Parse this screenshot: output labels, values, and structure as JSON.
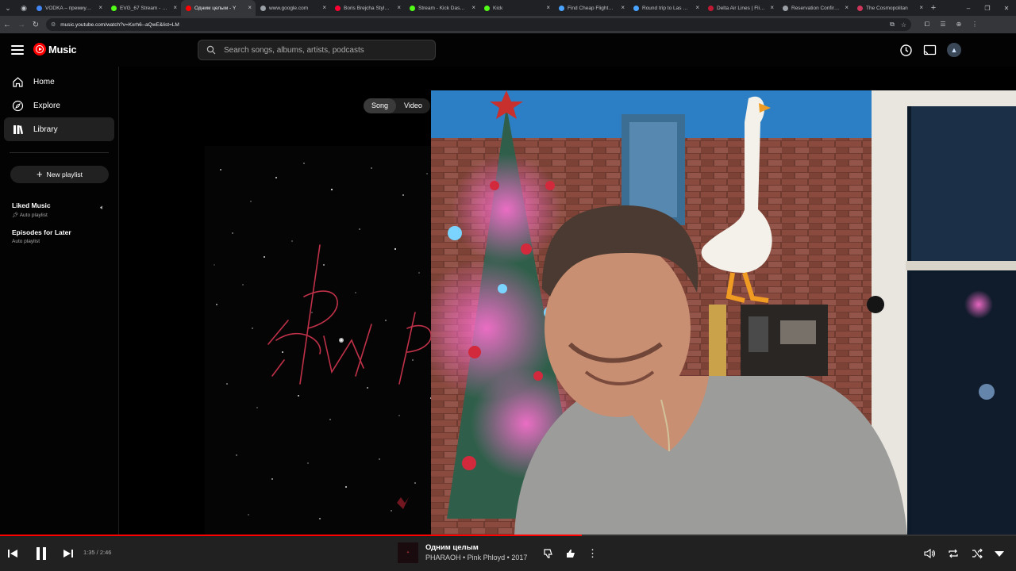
{
  "browser": {
    "tabs": [
      {
        "title": "VODKA – премиум с",
        "fav": "#4285f4"
      },
      {
        "title": "EVG_67 Stream - Watc",
        "fav": "#53fc18"
      },
      {
        "title": "Одним целым - Y",
        "fav": "#ff0000",
        "active": true
      },
      {
        "title": "www.google.com",
        "fav": "#9aa0a6"
      },
      {
        "title": "Boris Brejcha Style M",
        "fav": "#ff0033"
      },
      {
        "title": "Stream - Kick Dashbo",
        "fav": "#53fc18"
      },
      {
        "title": "Kick",
        "fav": "#53fc18"
      },
      {
        "title": "Find Cheap Flights fro",
        "fav": "#4aa3ff"
      },
      {
        "title": "Round trip to Las Veg",
        "fav": "#4aa3ff"
      },
      {
        "title": "Delta Air Lines | Fligh",
        "fav": "#c01933"
      },
      {
        "title": "Reservation Confirma",
        "fav": "#9aa0a6"
      },
      {
        "title": "The Cosmopolitan",
        "fav": "#d0355b"
      }
    ],
    "url": "music.youtube.com/watch?v=Kxrh6--aQwE&list=LM"
  },
  "header": {
    "logo_text": "Music",
    "search_placeholder": "Search songs, albums, artists, podcasts"
  },
  "sidebar": {
    "nav": [
      {
        "label": "Home"
      },
      {
        "label": "Explore"
      },
      {
        "label": "Library"
      }
    ],
    "new_playlist": "New playlist",
    "playlists": [
      {
        "title": "Liked Music",
        "subtitle": "Auto playlist"
      },
      {
        "title": "Episodes for Later",
        "subtitle": "Auto playlist"
      }
    ]
  },
  "main": {
    "toggle": {
      "song": "Song",
      "video": "Video"
    }
  },
  "player": {
    "time": "1:35 / 2:46",
    "progress": 0.573,
    "title": "Одним целым",
    "meta": "PHARAOH • Pink Phloyd • 2017"
  },
  "colors": {
    "accent": "#ff0000",
    "background": "#030303",
    "player_bar": "#212121"
  }
}
